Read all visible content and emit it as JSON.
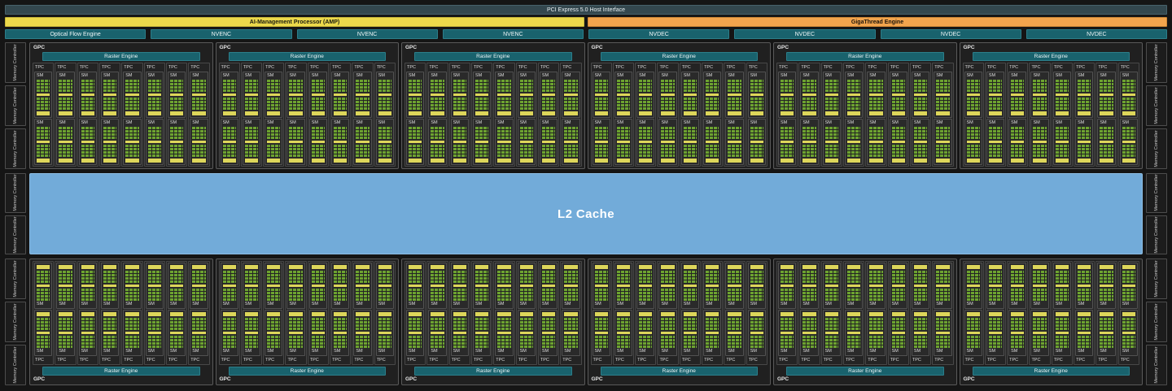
{
  "colors": {
    "background": "#151515",
    "engine_teal": "#19626d",
    "amp_yellow": "#ecd94b",
    "gigathread_orange": "#f2a44d",
    "l2_blue": "#72abd9",
    "core_green": "#6da330",
    "cache_yellow": "#ddd65a"
  },
  "host_interface": {
    "label": "PCI Express 5.0 Host Interface"
  },
  "amp": {
    "label": "AI-Management Processor (AMP)"
  },
  "gigathread": {
    "label": "GigaThread Engine"
  },
  "engines": [
    {
      "label": "Optical Flow Engine"
    },
    {
      "label": "NVENC"
    },
    {
      "label": "NVENC"
    },
    {
      "label": "NVENC"
    },
    {
      "label": "NVDEC"
    },
    {
      "label": "NVDEC"
    },
    {
      "label": "NVDEC"
    },
    {
      "label": "NVDEC"
    }
  ],
  "l2_cache": {
    "label": "L2 Cache"
  },
  "memory_controller": {
    "label": "Memory Controller",
    "left_count": 8,
    "right_count": 8,
    "groups": [
      3,
      2,
      3
    ]
  },
  "gpc": {
    "label": "GPC",
    "raster_engine_label": "Raster Engine",
    "tpc_label": "TPC",
    "sm_label": "SM",
    "top_row_count": 6,
    "bottom_row_count": 6,
    "tpcs_per_gpc": 8,
    "sms_per_tpc": 2
  }
}
